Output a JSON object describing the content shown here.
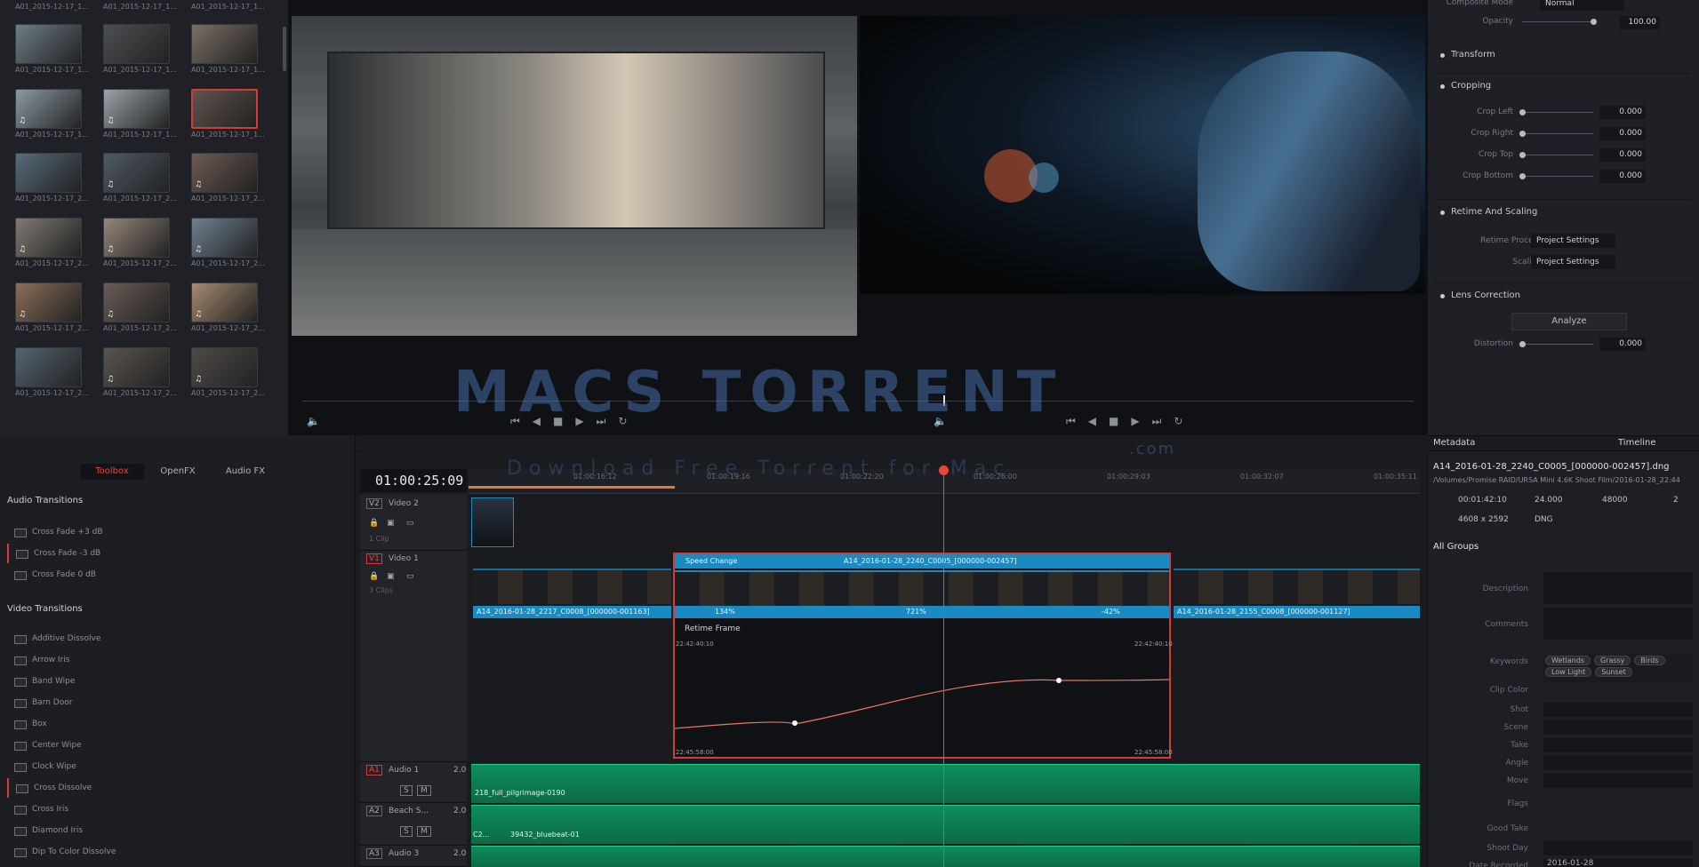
{
  "media_pool": {
    "clips": [
      {
        "name": "A01_2015-12-17_1...",
        "note": ""
      },
      {
        "name": "A01_2015-12-17_1...",
        "note": ""
      },
      {
        "name": "A01_2015-12-17_1...",
        "note": ""
      },
      {
        "name": "A01_2015-12-17_1...",
        "note": "♫"
      },
      {
        "name": "A01_2015-12-17_1...",
        "note": "♫"
      },
      {
        "name": "A01_2015-12-17_1...",
        "note": ""
      },
      {
        "name": "A01_2015-12-17_2...",
        "note": ""
      },
      {
        "name": "A01_2015-12-17_2...",
        "note": "♫"
      },
      {
        "name": "A01_2015-12-17_2...",
        "note": "♫"
      },
      {
        "name": "A01_2015-12-17_2...",
        "note": "♫"
      },
      {
        "name": "A01_2015-12-17_2...",
        "note": "♫"
      },
      {
        "name": "A01_2015-12-17_2...",
        "note": "♫"
      },
      {
        "name": "A01_2015-12-17_2...",
        "note": "♫"
      },
      {
        "name": "A01_2015-12-17_2...",
        "note": "♫"
      },
      {
        "name": "A01_2015-12-17_2...",
        "note": "♫"
      },
      {
        "name": "A01_2015-12-17_2...",
        "note": ""
      },
      {
        "name": "A01_2015-12-17_2...",
        "note": "♫"
      },
      {
        "name": "A01_2015-12-17_2...",
        "note": "♫"
      }
    ],
    "top_labels": [
      "A01_2015-12-17_1...",
      "A01_2015-12-17_1...",
      "A01_2015-12-17_1..."
    ]
  },
  "inspector": {
    "composite_mode_label": "Composite Mode",
    "composite_mode": "Normal",
    "opacity_label": "Opacity",
    "opacity": "100.00",
    "transform": "Transform",
    "cropping": "Cropping",
    "crop_left": "Crop Left",
    "crop_right": "Crop Right",
    "crop_top": "Crop Top",
    "crop_bottom": "Crop Bottom",
    "crop_value": "0.000",
    "retime": "Retime And Scaling",
    "retime_process": "Retime Process",
    "scaling": "Scaling",
    "project_settings": "Project Settings",
    "lens": "Lens Correction",
    "analyze": "Analyze",
    "distortion": "Distortion",
    "distortion_value": "0.000"
  },
  "toolbox": {
    "tabs": [
      "Toolbox",
      "OpenFX",
      "Audio FX"
    ],
    "audio_heading": "Audio Transitions",
    "audio": [
      "Cross Fade +3 dB",
      "Cross Fade -3 dB",
      "Cross Fade 0 dB"
    ],
    "video_heading": "Video Transitions",
    "video": [
      "Additive Dissolve",
      "Arrow Iris",
      "Band Wipe",
      "Barn Door",
      "Box",
      "Center Wipe",
      "Clock Wipe",
      "Cross Dissolve",
      "Cross Iris",
      "Diamond Iris",
      "Dip To Color Dissolve"
    ]
  },
  "timeline": {
    "timecode": "01:00:25:09",
    "ruler": [
      "01:00:16:12",
      "01:00:19:16",
      "01:00:22:20",
      "01:00:26:00",
      "01:00:29:03",
      "01:00:32:07",
      "01:00:35:11"
    ],
    "v2": {
      "id": "V2",
      "name": "Video 2",
      "count": "1 Clip"
    },
    "v1": {
      "id": "V1",
      "name": "Video 1",
      "count": "3 Clips"
    },
    "a1": {
      "id": "A1",
      "name": "Audio 1",
      "level": "2.0"
    },
    "a2": {
      "id": "A2",
      "name": "Beach S...",
      "level": "2.0"
    },
    "a3": {
      "id": "A3",
      "name": "Audio 3",
      "level": "2.0"
    },
    "clip1": "A14_2016-01-28_2217_C0008_[000000-001163]",
    "speed_change": "Speed Change",
    "clip2": "A14_2016-01-28_2240_C0005_[000000-002457]",
    "clip3": "A14_2016-01-28_2155_C0008_[000000-001127]",
    "speed1": "134%",
    "speed2": "721%",
    "speed3": "-42%",
    "retime_frame": "Retime Frame",
    "tc_top_left": "22:42:40:10",
    "tc_top_right": "22:42:40:10",
    "tc_bot_left": "22:45:58:00",
    "tc_bot_right": "22:45:58:00",
    "audio1_clip": "218_full_pilgrimage-0190",
    "audio2_prefix": "C2...",
    "audio2_clip": "39432_bluebeat-01",
    "track_buttons": [
      "S",
      "M"
    ]
  },
  "metadata": {
    "title": "Metadata",
    "tab_timeline": "Timeline",
    "filename": "A14_2016-01-28_2240_C0005_[000000-002457].dng",
    "path": "/Volumes/Promise RAID/URSA Mini 4.6K Shoot Film/2016-01-28_22:44",
    "duration": "00:01:42:10",
    "fps": "24.000",
    "sr": "48000",
    "ch": "2",
    "res": "4608 x 2592",
    "codec": "DNG",
    "all_groups": "All Groups",
    "labels": [
      "Description",
      "Comments",
      "Keywords",
      "Clip Color",
      "Shot",
      "Scene",
      "Take",
      "Angle",
      "Move",
      "Flags",
      "Good Take",
      "Shoot Day",
      "Date Recorded"
    ],
    "keywords": [
      "Wetlands",
      "Grassy",
      "Birds",
      "Low Light",
      "Sunset"
    ],
    "date_recorded": "2016-01-28"
  },
  "watermark": {
    "title": "MACS TORRENT",
    "sub": "Download Free Torrent for Mac",
    "com": ".com"
  },
  "colors": {
    "accent": "#1a8ac2",
    "playhead": "#e8463a",
    "audio": "#0f8d5d",
    "selection": "#d33a3a"
  }
}
